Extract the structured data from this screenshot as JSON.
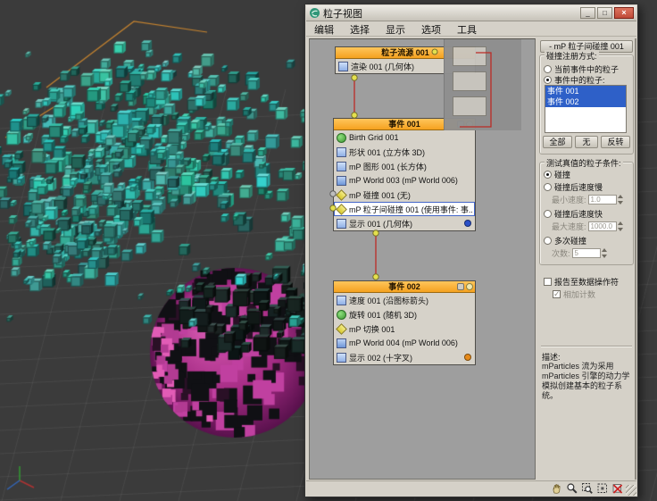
{
  "colors": {
    "close_red": "#c04a38",
    "header_orange": "#f5a11f",
    "selection_blue": "#2e60c8",
    "wire_red": "#bb2b25",
    "connector_yellow": "#e4e04e",
    "display_dot_blue": "#2a50c8",
    "display_dot_orange": "#e68a1a",
    "viewport_bg": "#3b3b3b",
    "pf_icon_orange": "#c5832f"
  },
  "window": {
    "title": "粒子视图",
    "buttons": {
      "minimize": "_",
      "maximize": "□",
      "close": "×"
    },
    "menus": [
      "编辑",
      "选择",
      "显示",
      "选项",
      "工具"
    ]
  },
  "canvas": {
    "source": {
      "title": "粒子流源 001",
      "items": [
        {
          "label": "渲染 001 (几何体)"
        }
      ]
    },
    "event1": {
      "title": "事件 001",
      "items": [
        {
          "label": "Birth Grid 001"
        },
        {
          "label": "形状 001 (立方体 3D)"
        },
        {
          "label": "mP 图形 001 (长方体)"
        },
        {
          "label": "mP World 003 (mP World 006)"
        },
        {
          "label": "mP 碰撞 001 (无)"
        },
        {
          "label": "mP 粒子间碰撞 001 (使用事件: 事..."
        },
        {
          "label": "显示 001 (几何体)"
        }
      ]
    },
    "event2": {
      "title": "事件 002",
      "items": [
        {
          "label": "速度 001 (沿图标箭头)"
        },
        {
          "label": "旋转 001 (随机 3D)"
        },
        {
          "label": "mP 切换 001"
        },
        {
          "label": "mP World 004 (mP World 006)"
        },
        {
          "label": "显示 002 (十字叉)"
        }
      ]
    }
  },
  "panel": {
    "collapse_glyph": "-",
    "title": "mP 粒子间碰撞 001",
    "register": {
      "title": "碰撞注册方式:",
      "option_current": "当前事件中的粒子",
      "option_events": "事件中的粒子:",
      "events": [
        "事件 001",
        "事件 002"
      ],
      "buttons": [
        "全部",
        "无",
        "反转"
      ]
    },
    "condition": {
      "title": "测试真值的粒子条件:",
      "collision": "碰撞",
      "slow": "碰撞后速度慢",
      "slow_field": "最小速度:",
      "slow_value": "1.0",
      "fast": "碰撞后速度快",
      "fast_field": "最大速度:",
      "fast_value": "1000.0",
      "multi": "多次碰撞",
      "multi_field": "次数:",
      "multi_value": "5"
    },
    "report_label": "报告至数据操作符",
    "accumulate_label": "相加计数",
    "description_label": "描述:",
    "description": "mParticles 流为采用 mParticles 引擎的动力学模拟创建基本的粒子系统。"
  }
}
